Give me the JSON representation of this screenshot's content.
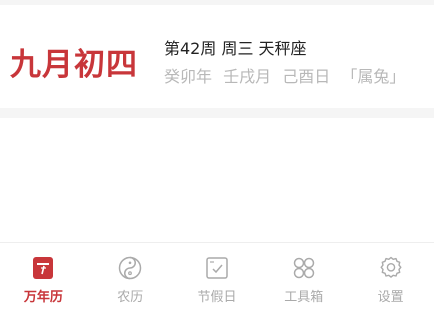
{
  "header": {
    "lunar_date": "九月初四",
    "week_info": "第42周 周三 天秤座",
    "ganzhi": {
      "year": "癸卯年",
      "month": "壬戌月",
      "day": "己酉日",
      "zodiac": "「属兔」"
    }
  },
  "tabs": [
    {
      "label": "万年历",
      "icon": "calendar-icon",
      "active": true
    },
    {
      "label": "农历",
      "icon": "yin-yang-icon",
      "active": false
    },
    {
      "label": "节假日",
      "icon": "holiday-check-icon",
      "active": false
    },
    {
      "label": "工具箱",
      "icon": "grid-icon",
      "active": false
    },
    {
      "label": "设置",
      "icon": "gear-icon",
      "active": false
    }
  ],
  "colors": {
    "accent": "#c8363a",
    "inactive": "#aaaaaa",
    "muted_text": "#b8b8b8"
  }
}
